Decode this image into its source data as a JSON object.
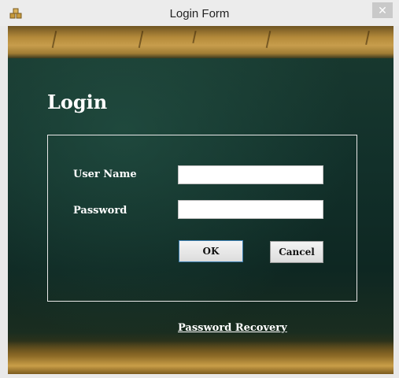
{
  "window": {
    "title": "Login Form",
    "close_label": "✕"
  },
  "form": {
    "heading": "Login",
    "username_label": "User Name",
    "username_value": "",
    "password_label": "Password",
    "password_value": "",
    "ok_label": "OK",
    "cancel_label": "Cancel",
    "recovery_label": "Password Recovery"
  },
  "colors": {
    "board": "#12302a",
    "wood": "#b48a3a",
    "ok_border": "#3c7fb1"
  },
  "icons": {
    "app": "app-window-icon",
    "close": "close-icon"
  }
}
